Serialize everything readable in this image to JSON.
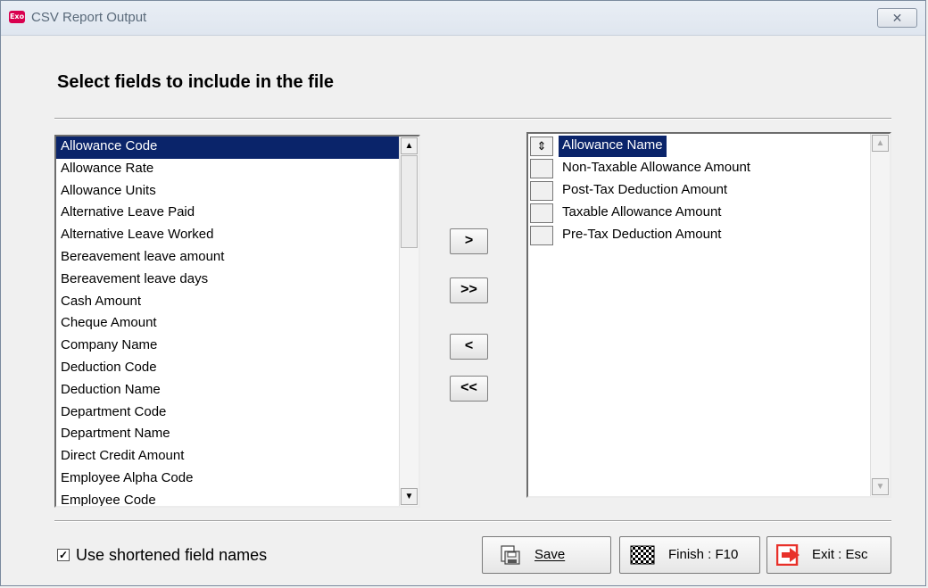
{
  "window": {
    "title": "CSV Report Output",
    "app_icon_text": "Exo",
    "close_glyph": "✕"
  },
  "heading": "Select fields to include in the file",
  "available_fields": [
    "Allowance Code",
    "Allowance Rate",
    "Allowance Units",
    "Alternative Leave Paid",
    "Alternative Leave Worked",
    "Bereavement leave amount",
    "Bereavement leave days",
    "Cash Amount",
    "Cheque Amount",
    "Company Name",
    "Deduction Code",
    "Deduction Name",
    "Department Code",
    "Department Name",
    "Direct Credit Amount",
    "Employee Alpha Code",
    "Employee Code"
  ],
  "available_selected_index": 0,
  "selected_fields": [
    "Allowance Name",
    "Non-Taxable Allowance Amount",
    "Post-Tax Deduction Amount",
    "Taxable Allowance Amount",
    "Pre-Tax Deduction Amount"
  ],
  "selected_selected_index": 0,
  "move_buttons": {
    "add": ">",
    "add_all": ">>",
    "remove": "<",
    "remove_all": "<<"
  },
  "options": {
    "shortened_names_label": "Use shortened field names",
    "shortened_names_checked": true
  },
  "actions": {
    "save_label": "Save",
    "finish_label": "Finish : F10",
    "exit_label": "Exit : Esc"
  },
  "icons": {
    "app": "exo-icon",
    "save": "save-icon",
    "finish": "checkered-flag-icon",
    "exit": "exit-icon",
    "drag": "drag-handle-icon"
  },
  "colors": {
    "selection": "#0a246a",
    "exit_icon": "#e8312a",
    "app_icon": "#d9004f"
  }
}
